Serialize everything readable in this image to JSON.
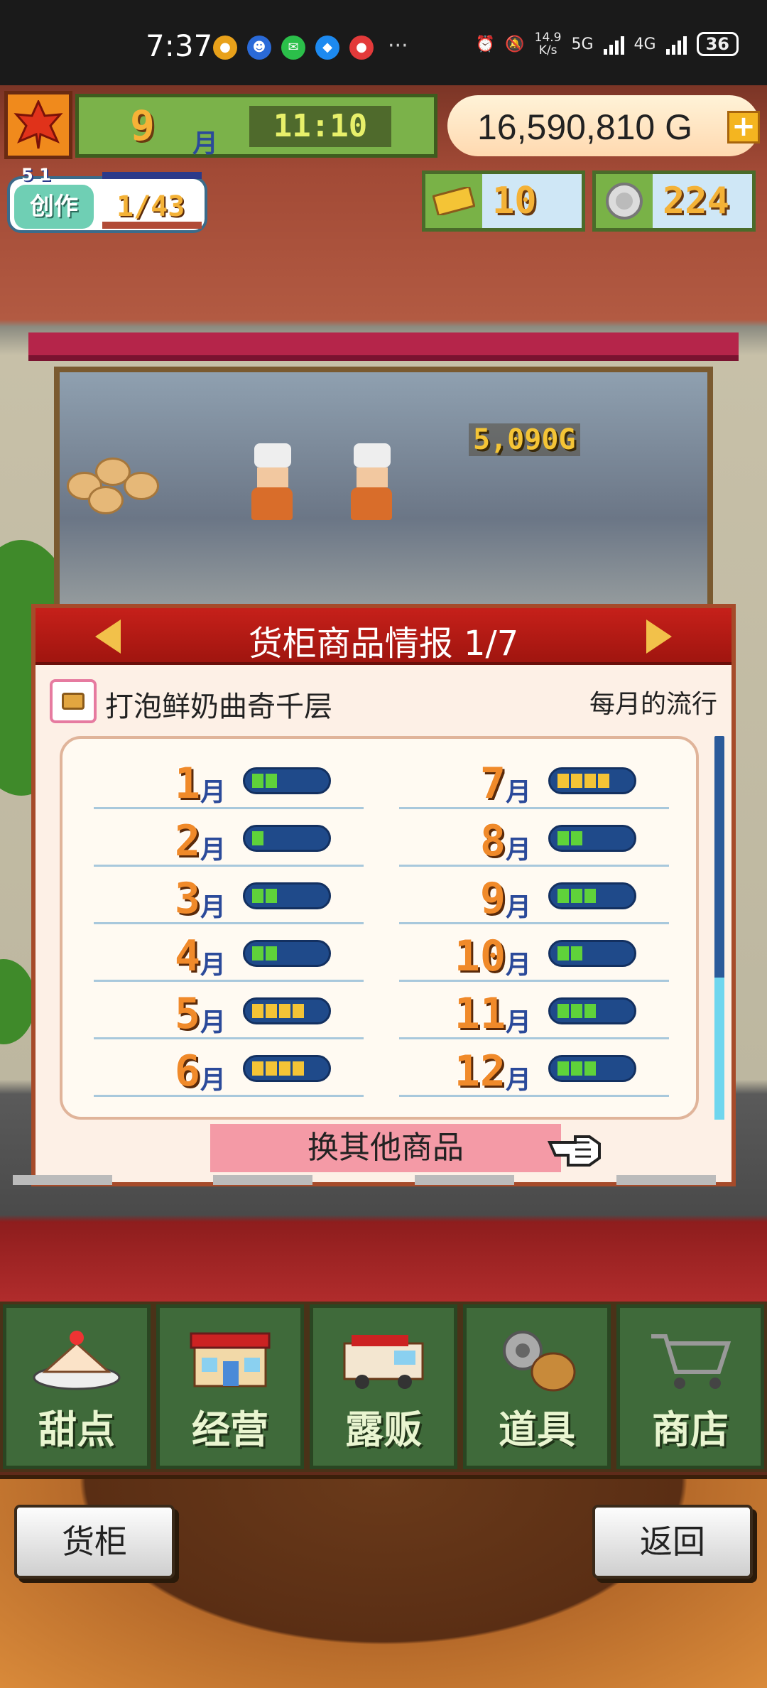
{
  "status_bar": {
    "time": "7:37",
    "net_speed": "14.9",
    "net_unit": "K/s",
    "network_5g": "5G",
    "network_4g": "4G",
    "battery": "36"
  },
  "hud": {
    "month_num": "9",
    "month_unit": "月",
    "clock": "11:10",
    "gold": "16,590,810 G",
    "craft_label": "创作",
    "craft_level": "5 1",
    "craft_progress": "1/43",
    "tickets": "10",
    "medals": "224"
  },
  "scene": {
    "price_popup": "5,090G"
  },
  "dialog": {
    "title": "货柜商品情报 1/7",
    "product_name": "打泡鲜奶曲奇千层",
    "trend_label": "每月的流行",
    "month_unit": "月",
    "months": [
      {
        "num": "1",
        "level": 2
      },
      {
        "num": "2",
        "level": 1
      },
      {
        "num": "3",
        "level": 2
      },
      {
        "num": "4",
        "level": 2
      },
      {
        "num": "5",
        "level": 4
      },
      {
        "num": "6",
        "level": 4
      },
      {
        "num": "7",
        "level": 4
      },
      {
        "num": "8",
        "level": 2
      },
      {
        "num": "9",
        "level": 3
      },
      {
        "num": "10",
        "level": 2
      },
      {
        "num": "11",
        "level": 3
      },
      {
        "num": "12",
        "level": 3
      }
    ],
    "switch_button": "换其他商品"
  },
  "nav": {
    "items": [
      {
        "label": "甜点",
        "icon": "cake-icon"
      },
      {
        "label": "经营",
        "icon": "shop-building-icon"
      },
      {
        "label": "露贩",
        "icon": "food-truck-icon"
      },
      {
        "label": "道具",
        "icon": "gear-bag-icon"
      },
      {
        "label": "商店",
        "icon": "shopping-cart-icon"
      }
    ],
    "cabinet_button": "货柜",
    "back_button": "返回"
  },
  "colors": {
    "gauge_green": "#5fd23a",
    "gauge_yellow": "#f4c436",
    "gauge_empty": "#1f4a8a",
    "header_red": "#c6201a",
    "nav_green": "#3f6a3a"
  }
}
